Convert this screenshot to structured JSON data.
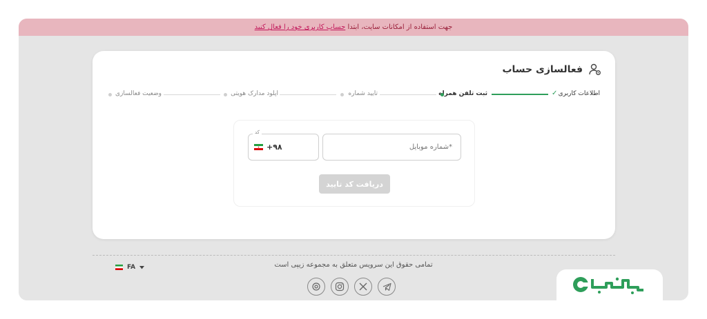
{
  "banner": {
    "text": "جهت استفاده از امکانات سایت، ابتدا",
    "link": "حساب کاربری خود را فعال کنید"
  },
  "card": {
    "title": "فعالسازی حساب",
    "steps": [
      {
        "label": "اطلاعات کاربری",
        "state": "done"
      },
      {
        "label": "ثبت تلفن همراه",
        "state": "active"
      },
      {
        "label": "تایید شماره",
        "state": "pending"
      },
      {
        "label": "اپلود مدارک هویتی",
        "state": "pending"
      },
      {
        "label": "وضعیت فعالسازی",
        "state": "pending"
      }
    ]
  },
  "form": {
    "phone_placeholder": "*شماره موبایل",
    "code_label": "کد",
    "code_value": "+۹۸",
    "submit_label": "دریافت کد تایید"
  },
  "footer": {
    "copyright": "تمامی حقوق این سرویس متعلق به مجموعه زیپی است",
    "language": "FA",
    "social": [
      "telegram-icon",
      "x-icon",
      "instagram-icon",
      "support-icon"
    ]
  },
  "logo": {
    "alt": "SOODUP"
  },
  "colors": {
    "accent": "#2e9e5a",
    "banner_bg": "#e8b6be",
    "banner_link": "#c2185b",
    "disabled_button": "#d4d4d4"
  }
}
